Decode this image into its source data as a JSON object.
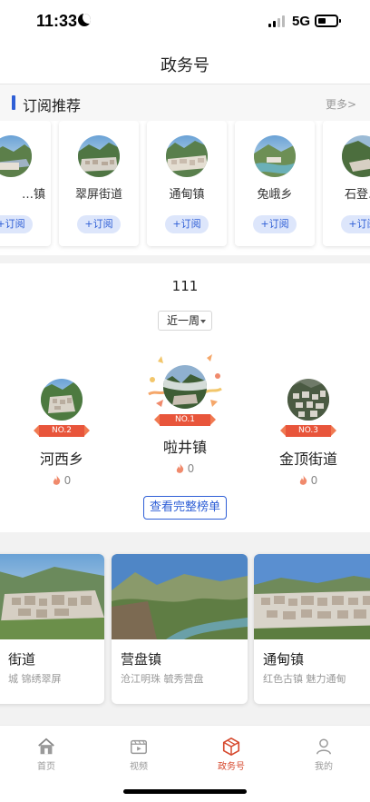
{
  "status_bar": {
    "time": "11:33",
    "network": "5G"
  },
  "header": {
    "title": "政务号"
  },
  "subscribe_section": {
    "title": "订阅推荐",
    "more": "更多>",
    "button_label": "+订阅",
    "items": [
      {
        "name": "…镇"
      },
      {
        "name": "翠屏街道"
      },
      {
        "name": "通甸镇"
      },
      {
        "name": "兔峨乡"
      },
      {
        "name": "石登…"
      }
    ]
  },
  "ranking_section": {
    "title": "111",
    "period": "近一周",
    "full_list_label": "查看完整榜单",
    "podium": [
      {
        "rank_label": "NO.2",
        "name": "河西乡",
        "heat": "0"
      },
      {
        "rank_label": "NO.1",
        "name": "啦井镇",
        "heat": "0"
      },
      {
        "rank_label": "NO.3",
        "name": "金顶街道",
        "heat": "0"
      }
    ]
  },
  "town_cards": [
    {
      "name": "街道",
      "desc": "城 锦绣翠屏"
    },
    {
      "name": "营盘镇",
      "desc": "沧江明珠 毓秀营盘"
    },
    {
      "name": "通甸镇",
      "desc": "红色古镇 魅力通甸"
    }
  ],
  "tab_bar": {
    "items": [
      {
        "label": "首页",
        "icon": "home-icon"
      },
      {
        "label": "视频",
        "icon": "video-icon"
      },
      {
        "label": "政务号",
        "icon": "cube-icon"
      },
      {
        "label": "我的",
        "icon": "person-icon"
      }
    ],
    "active": "政务号"
  },
  "colors": {
    "accent": "#2f5fd6",
    "ribbon": "#e8553b",
    "active_tab": "#d64a2f"
  }
}
